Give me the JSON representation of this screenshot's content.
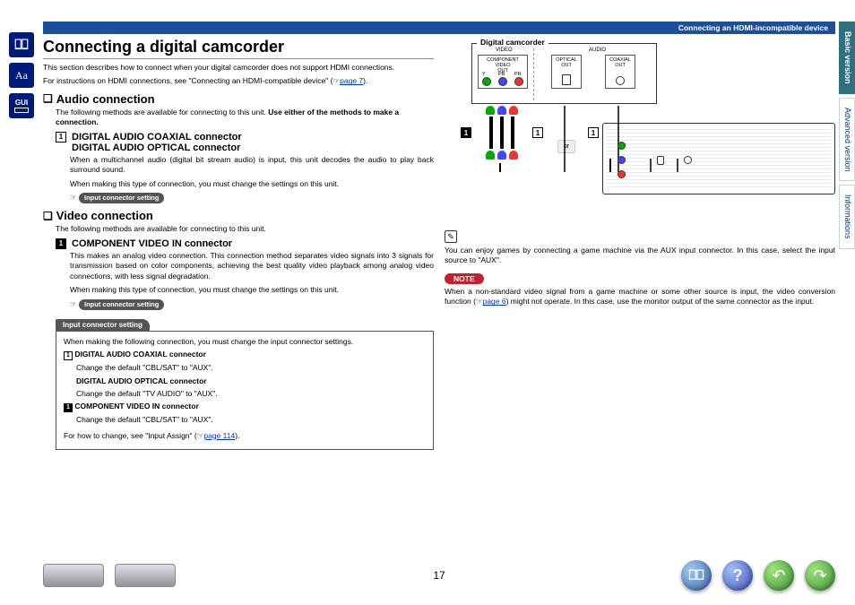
{
  "header": {
    "breadcrumb": "Connecting an HDMI-incompatible device"
  },
  "rightTabs": [
    "Basic version",
    "Advanced version",
    "Informations"
  ],
  "title": "Connecting a digital camcorder",
  "intro": {
    "p1": "This section describes how to connect when your digital camcorder does not support HDMI connections.",
    "p2a": "For instructions on HDMI connections, see \"Connecting an HDMI-compatible device\" (",
    "p2link": "page 7",
    "p2b": ")."
  },
  "audio": {
    "heading": "Audio connection",
    "p1a": "The following methods are available for connecting to this unit. ",
    "p1b": "Use either of the methods to make a connection.",
    "sub1a": "DIGITAL AUDIO COAXIAL connector",
    "sub1b": "DIGITAL AUDIO OPTICAL connector",
    "body1": "When a multichannel audio (digital bit stream audio) is input, this unit decodes the audio to play back surround sound.",
    "body2": "When making this type of connection, you must change the settings on this unit.",
    "pill": "Input connector setting"
  },
  "video": {
    "heading": "Video connection",
    "p1": "The following methods are available for connecting to this unit.",
    "sub": "COMPONENT VIDEO IN connector",
    "body1": "This makes an analog video connection. This connection method separates video signals into 3 signals for transmission based on color components, achieving the best quality video playback among analog video connections, with less signal degradation.",
    "body2": "When making this type of connection, you must change the settings on this unit.",
    "pill": "Input connector setting"
  },
  "box": {
    "tab": "Input connector setting",
    "intro": "When making the following connection, you must change the input connector settings.",
    "item1t": "DIGITAL AUDIO COAXIAL connector",
    "item1b": "Change the default \"CBL/SAT\" to \"AUX\".",
    "item2t": "DIGITAL AUDIO OPTICAL connector",
    "item2b": "Change the default \"TV AUDIO\" to \"AUX\".",
    "item3t": "COMPONENT VIDEO IN connector",
    "item3b": "Change the default \"CBL/SAT\" to \"AUX\".",
    "foot_a": "For how to change, see \"Input Assign\" (",
    "foot_link": "page 114",
    "foot_b": ")."
  },
  "diagram": {
    "title": "Digital camcorder",
    "labels": {
      "video": "VIDEO",
      "audio": "AUDIO",
      "cv_out": "COMPONENT VIDEO\nOUT",
      "opt_out": "OPTICAL\nOUT",
      "coax_out": "COAXIAL\nOUT",
      "y": "Y",
      "pb": "PB",
      "pr": "PR",
      "or": "or"
    },
    "badge1": "1",
    "badge1_black": "1"
  },
  "rightcol": {
    "tip": "You can enjoy games by connecting a game machine via the AUX input connector. In this case, select the input source to \"AUX\".",
    "note_label": "NOTE",
    "note_a": "When a non-standard video signal from a game machine or some other source is input, the video conversion function (",
    "note_link": "page 6",
    "note_b": ") might not operate. In this case, use the monitor output of the same connector as the input."
  },
  "footer": {
    "page": "17"
  },
  "icons": {
    "hand": "✎",
    "pointer": "☞"
  }
}
